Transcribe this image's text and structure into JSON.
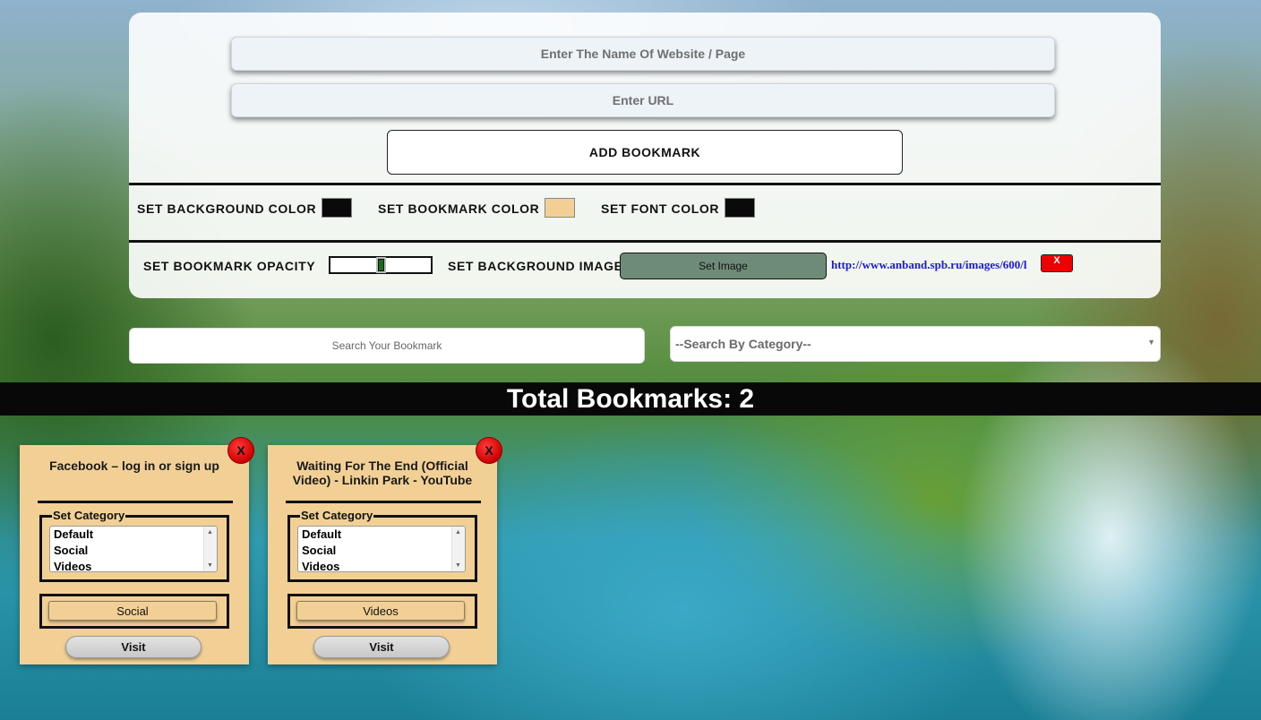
{
  "form": {
    "name_placeholder": "Enter The Name Of Website / Page",
    "url_placeholder": "Enter URL",
    "add_label": "ADD BOOKMARK"
  },
  "settings": {
    "background_color_label": "SET BACKGROUND COLOR",
    "background_color": "#0a0a0a",
    "bookmark_color_label": "SET BOOKMARK COLOR",
    "bookmark_color": "#f2d095",
    "font_color_label": "SET FONT COLOR",
    "font_color": "#0a0a0a",
    "opacity_label": "SET BOOKMARK OPACITY",
    "opacity_value": 0.5,
    "background_image_label": "SET BACKGROUND IMAGE",
    "set_image_label": "Set Image",
    "image_url": "http://www.anband.spb.ru/images/600/l",
    "clear_image_label": "X"
  },
  "search": {
    "placeholder": "Search Your Bookmark",
    "category_default": "--Search By Category--",
    "category_arrow": "▼"
  },
  "total": {
    "text": "Total Bookmarks: 2"
  },
  "bookmarks": [
    {
      "title": "Facebook – log in or sign up",
      "close_label": "X",
      "category_legend": "Set Category",
      "category_options": [
        "Default",
        "Social",
        "Videos"
      ],
      "current_category": "Social",
      "visit_label": "Visit"
    },
    {
      "title": "Waiting For The End (Official Video) - Linkin Park - YouTube",
      "close_label": "X",
      "category_legend": "Set Category",
      "category_options": [
        "Default",
        "Social",
        "Videos"
      ],
      "current_category": "Videos",
      "visit_label": "Visit"
    }
  ]
}
